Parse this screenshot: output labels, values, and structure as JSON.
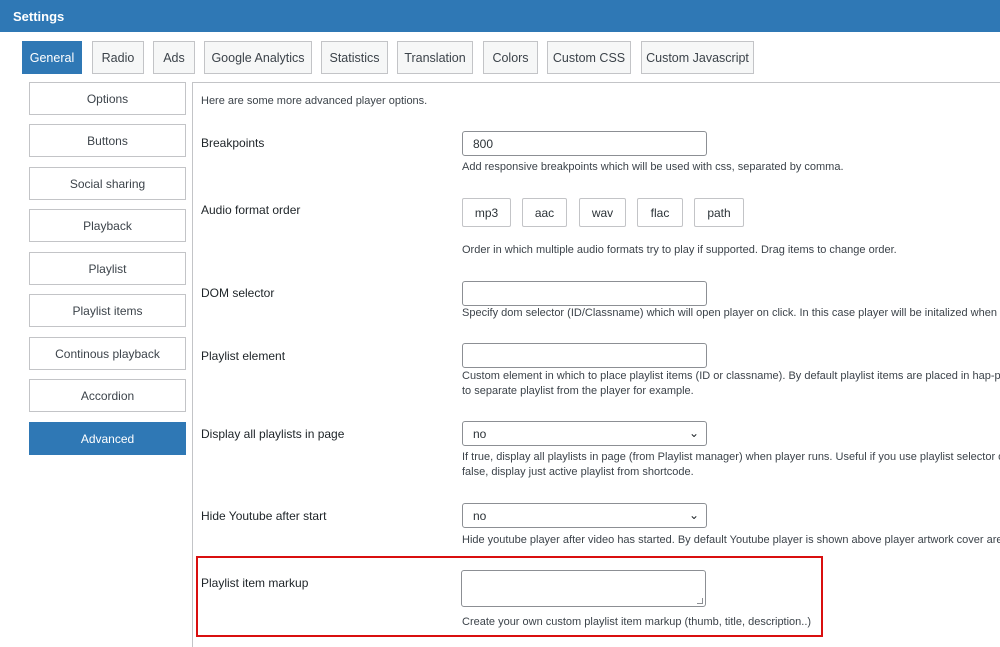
{
  "header": {
    "title": "Settings"
  },
  "tabs": [
    {
      "label": "General"
    },
    {
      "label": "Radio"
    },
    {
      "label": "Ads"
    },
    {
      "label": "Google Analytics"
    },
    {
      "label": "Statistics"
    },
    {
      "label": "Translation"
    },
    {
      "label": "Colors"
    },
    {
      "label": "Custom CSS"
    },
    {
      "label": "Custom Javascript"
    }
  ],
  "sidebar": {
    "items": [
      {
        "label": "Options"
      },
      {
        "label": "Buttons"
      },
      {
        "label": "Social sharing"
      },
      {
        "label": "Playback"
      },
      {
        "label": "Playlist"
      },
      {
        "label": "Playlist items"
      },
      {
        "label": "Continous playback"
      },
      {
        "label": "Accordion"
      },
      {
        "label": "Advanced"
      }
    ]
  },
  "main": {
    "intro": "Here are some more advanced player options.",
    "breakpoints": {
      "label": "Breakpoints",
      "value": "800",
      "desc": "Add responsive breakpoints which will be used with css, separated by comma."
    },
    "audio_format": {
      "label": "Audio format order",
      "formats": [
        "mp3",
        "aac",
        "wav",
        "flac",
        "path"
      ],
      "desc": "Order in which multiple audio formats try to play if supported. Drag items to change order."
    },
    "dom_selector": {
      "label": "DOM selector",
      "value": "",
      "desc": "Specify dom selector (ID/Classname) which will open player on click. In this case player will be initalized when user c"
    },
    "playlist_element": {
      "label": "Playlist element",
      "value": "",
      "desc_line1": "Custom element in which to place playlist items (ID or classname). By default playlist items are placed in hap-playlist",
      "desc_line2": "to separate playlist from the player for example."
    },
    "display_all": {
      "label": "Display all playlists in page",
      "value": "no",
      "desc_line1": "If true, display all playlists in page (from Playlist manager) when player runs. Useful if you use playlist selector or if y",
      "desc_line2": "false, display just active playlist from shortcode."
    },
    "hide_youtube": {
      "label": "Hide Youtube after start",
      "value": "no",
      "desc": "Hide youtube player after video has started. By default Youtube player is shown above player artwork cover area."
    },
    "item_markup": {
      "label": "Playlist item markup",
      "value": "",
      "desc": "Create your own custom playlist item markup (thumb, title, description..)"
    }
  },
  "colors": {
    "accent": "#2f78b5",
    "highlight": "#d90f0f"
  }
}
